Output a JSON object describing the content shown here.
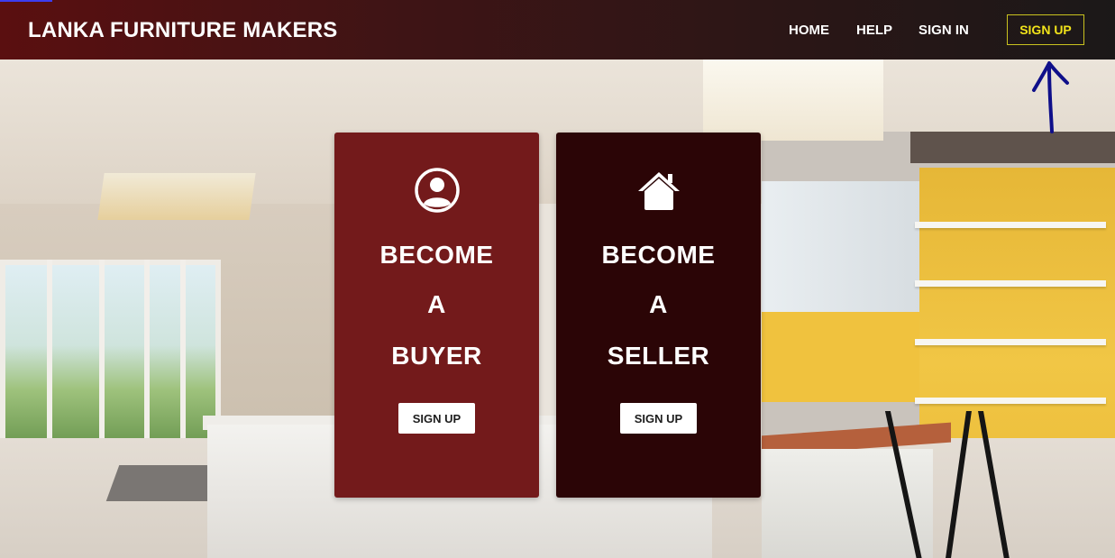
{
  "navbar": {
    "brand": "LANKA FURNITURE MAKERS",
    "links": [
      {
        "label": "HOME"
      },
      {
        "label": "HELP"
      },
      {
        "label": "SIGN IN"
      }
    ],
    "signup_label": "SIGN UP"
  },
  "cards": [
    {
      "icon": "user-circle-icon",
      "lines": [
        "BECOME",
        "A",
        "BUYER"
      ],
      "button_label": "SIGN UP",
      "color": "#731a1b"
    },
    {
      "icon": "home-icon",
      "lines": [
        "BECOME",
        "A",
        "SELLER"
      ],
      "button_label": "SIGN UP",
      "color": "#2b0506"
    }
  ],
  "colors": {
    "accent_yellow": "#f1e31a",
    "annotation_arrow": "#0f0f8a"
  }
}
